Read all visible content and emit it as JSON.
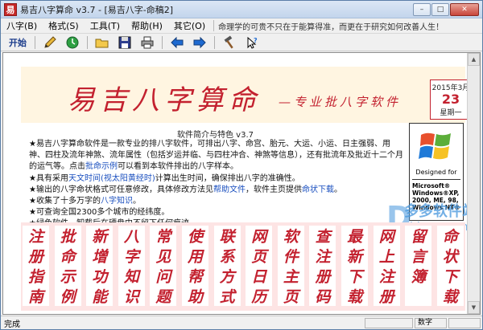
{
  "window": {
    "app_icon_glyph": "易",
    "title": "易吉八字算命 v3.7 - [易吉八字-命稿2]",
    "controls": {
      "minimize": "–",
      "maximize": "□",
      "close": "✕"
    }
  },
  "menu": {
    "items": [
      "八字(B)",
      "格式(S)",
      "工具(T)",
      "帮助(H)",
      "其它(O)"
    ],
    "hint": "命理学的可贵不只在于能算得准，而更在于研究如何改善人生！"
  },
  "toolbar": {
    "start_label": "开始",
    "icons": [
      "pencil-icon",
      "clock-icon",
      "open-folder-icon",
      "save-icon",
      "print-icon",
      "back-arrow-icon",
      "forward-arrow-icon",
      "hammer-icon",
      "help-icon"
    ]
  },
  "banner": {
    "title": "易吉八字算命",
    "subtitle": "—专业批八字软件",
    "date_ym": "2015年3月",
    "date_day": "23",
    "date_weekday": "星期一"
  },
  "intro": {
    "heading": "软件简介与特色 v3.7",
    "p1": "★易吉八字算命软件是一款专业的排八字软件，可排出八字、命宫、胎元、大运、小运、日主强弱、用神、四柱及流年神煞、流年属性（包括岁运并临、与四柱冲合、神煞等信息），还有批流年及批近十二个月的运气等。点击",
    "p1_link": "批命示例",
    "p1_tail": "可以看到本软件排出的八字样本。",
    "p2_pre": "★具有采用",
    "p2_link": "天文时间(视太阳黄经时)",
    "p2_tail": "计算出生时间，确保排出八字的准确性。",
    "p3_pre": "★输出的八字命状格式可任意修改，具体修改方法见",
    "p3_link1": "帮助文件",
    "p3_mid": "，软件主页提供",
    "p3_link2": "命状下载",
    "p3_tail": "。",
    "p4_pre": "★收集了十多万字的",
    "p4_link": "八字知识",
    "p4_tail": "。",
    "p5": "★可查询全国2300多个城市的经纬度。",
    "p6": "★绿色软件，卸载后在硬盘中不留下任何痕迹。"
  },
  "windows_logo": {
    "designed_for": "Designed for",
    "lines": [
      "Microsoft®",
      "Windows®XP,",
      "2000, ME, 98,",
      "Windows NT®"
    ]
  },
  "watermark": {
    "main": "多多软件站",
    "sub": "ddooo.com",
    "glyph": "D"
  },
  "columns": [
    {
      "chars": [
        "注",
        "册",
        "指",
        "南"
      ]
    },
    {
      "chars": [
        "批",
        "命",
        "示",
        "例"
      ]
    },
    {
      "chars": [
        "新",
        "增",
        "功",
        "能"
      ]
    },
    {
      "chars": [
        "八",
        "字",
        "知",
        "识"
      ]
    },
    {
      "chars": [
        "常",
        "见",
        "问",
        "题"
      ]
    },
    {
      "chars": [
        "使",
        "用",
        "帮",
        "助"
      ]
    },
    {
      "chars": [
        "联",
        "系",
        "方",
        "式"
      ]
    },
    {
      "chars": [
        "网",
        "页",
        "日",
        "历"
      ]
    },
    {
      "chars": [
        "软",
        "件",
        "主",
        "页"
      ]
    },
    {
      "chars": [
        "查",
        "注",
        "册",
        "码"
      ]
    },
    {
      "chars": [
        "最",
        "新",
        "下",
        "载"
      ]
    },
    {
      "chars": [
        "网",
        "上",
        "注",
        "册"
      ]
    },
    {
      "chars": [
        "留",
        "言",
        "簿"
      ]
    },
    {
      "chars": [
        "命",
        "状",
        "下",
        "载"
      ]
    }
  ],
  "status": {
    "left": "完成",
    "cells": [
      "",
      "数字",
      ""
    ]
  }
}
